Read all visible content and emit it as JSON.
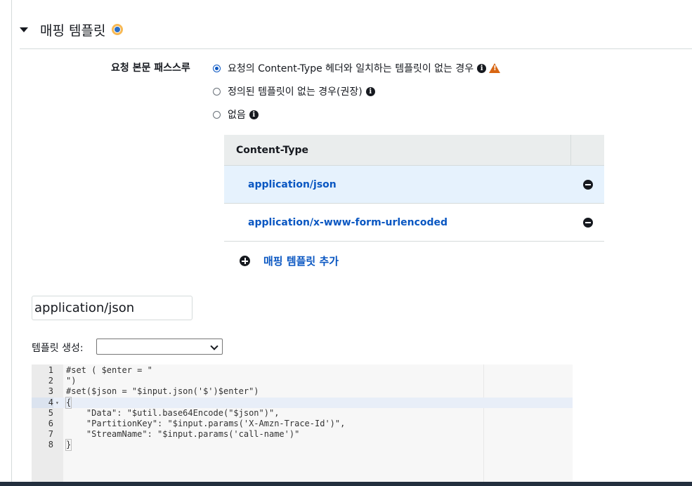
{
  "section": {
    "title": "매핑 템플릿"
  },
  "passthrough": {
    "label": "요청 본문 패스스루",
    "options": [
      {
        "label": "요청의 Content-Type 헤더와 일치하는 템플릿이 없는 경우",
        "checked": true,
        "warning": true
      },
      {
        "label": "정의된 템플릿이 없는 경우(권장)",
        "checked": false,
        "warning": false
      },
      {
        "label": "없음",
        "checked": false,
        "warning": false
      }
    ]
  },
  "content_types": {
    "header": "Content-Type",
    "rows": [
      {
        "label": "application/json",
        "selected": true
      },
      {
        "label": "application/x-www-form-urlencoded",
        "selected": false
      }
    ],
    "add_label": "매핑 템플릿 추가"
  },
  "editor_panel": {
    "content_type_value": "application/json",
    "generate_label": "템플릿 생성:",
    "generate_selected": ""
  },
  "code_editor": {
    "active_line": 4,
    "lines": [
      {
        "num": "1",
        "text": "#set ( $enter = \""
      },
      {
        "num": "2",
        "text": "\")"
      },
      {
        "num": "3",
        "text": "#set($json = \"$input.json('$')$enter\")"
      },
      {
        "num": "4",
        "text": "{"
      },
      {
        "num": "5",
        "text": "    \"Data\": \"$util.base64Encode(\"$json\")\","
      },
      {
        "num": "6",
        "text": "    \"PartitionKey\": \"$input.params('X-Amzn-Trace-Id')\","
      },
      {
        "num": "7",
        "text": "    \"StreamName\": \"$input.params('call-name')\""
      },
      {
        "num": "8",
        "text": "}"
      }
    ]
  },
  "colors": {
    "link": "#0a57c2",
    "warning": "#d86613",
    "info_badge": "#f7b955"
  }
}
